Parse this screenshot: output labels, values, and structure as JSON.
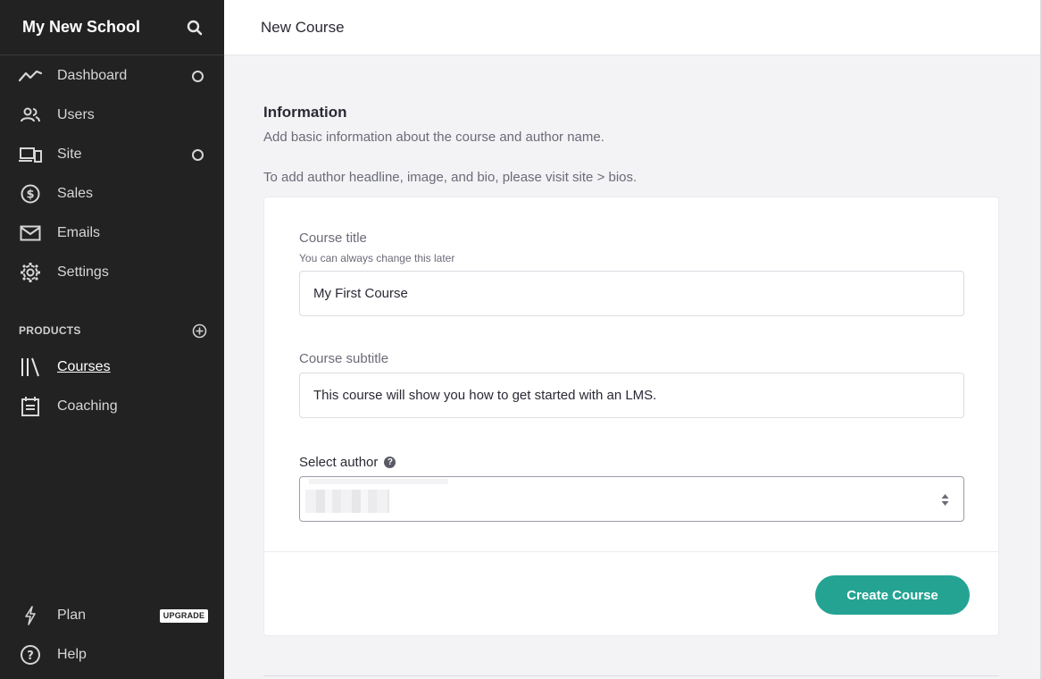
{
  "sidebar": {
    "school_name": "My New School",
    "nav": [
      {
        "label": "Dashboard",
        "icon": "chart-line-icon"
      },
      {
        "label": "Users",
        "icon": "users-icon"
      },
      {
        "label": "Site",
        "icon": "devices-icon"
      },
      {
        "label": "Sales",
        "icon": "dollar-icon"
      },
      {
        "label": "Emails",
        "icon": "mail-icon"
      },
      {
        "label": "Settings",
        "icon": "gear-icon"
      }
    ],
    "products_section": "PRODUCTS",
    "products": [
      {
        "label": "Courses",
        "icon": "library-icon",
        "active": true
      },
      {
        "label": "Coaching",
        "icon": "calendar-icon"
      }
    ],
    "footer": [
      {
        "label": "Plan",
        "icon": "lightning-icon",
        "badge": "UPGRADE"
      },
      {
        "label": "Help",
        "icon": "question-icon"
      }
    ]
  },
  "header": {
    "title": "New Course"
  },
  "information": {
    "title": "Information",
    "description": "Add basic information about the course and author name.",
    "note": "To add author headline, image, and bio, please visit site > bios."
  },
  "form": {
    "course_title": {
      "label": "Course title",
      "hint": "You can always change this later",
      "value": "My First Course"
    },
    "course_subtitle": {
      "label": "Course subtitle",
      "value": "This course will show you how to get started with an LMS."
    },
    "author": {
      "label": "Select author",
      "help": "?"
    },
    "submit_label": "Create Course"
  },
  "colors": {
    "sidebar_bg": "#222222",
    "accent": "#24a393",
    "page_bg": "#f3f3f6"
  }
}
